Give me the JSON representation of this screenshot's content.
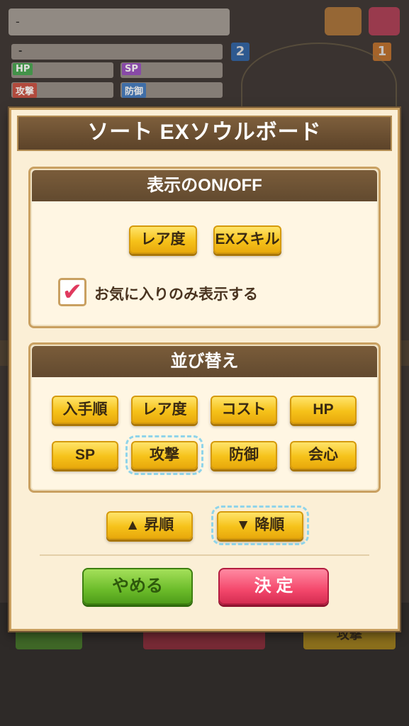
{
  "background": {
    "top_field": "-",
    "field2": "-",
    "stats": [
      {
        "label": "HP",
        "value": "-",
        "color": "#2e9a3a"
      },
      {
        "label": "SP",
        "value": "-",
        "color": "#8a3ab8"
      },
      {
        "label": "攻撃",
        "value": "-",
        "color": "#c03a2a"
      },
      {
        "label": "防御",
        "value": "-",
        "color": "#2a6ab8"
      }
    ],
    "slot_numbers": [
      "2",
      "1"
    ],
    "bottom_right_button": "攻撃"
  },
  "modal": {
    "title": "ソート EXソウルボード",
    "display_section": {
      "heading": "表示のON/OFF",
      "buttons": [
        "レア度",
        "EXスキル"
      ],
      "favorites_checkbox": {
        "label": "お気に入りのみ表示する",
        "checked": true,
        "mark": "✔"
      }
    },
    "sort_section": {
      "heading": "並び替え",
      "buttons": [
        "入手順",
        "レア度",
        "コスト",
        "HP",
        "SP",
        "攻撃",
        "防御",
        "会心"
      ],
      "selected": "攻撃"
    },
    "order": {
      "asc": "▲ 昇順",
      "desc": "▼ 降順",
      "selected": "desc"
    },
    "cancel_label": "やめる",
    "confirm_label": "決 定"
  }
}
